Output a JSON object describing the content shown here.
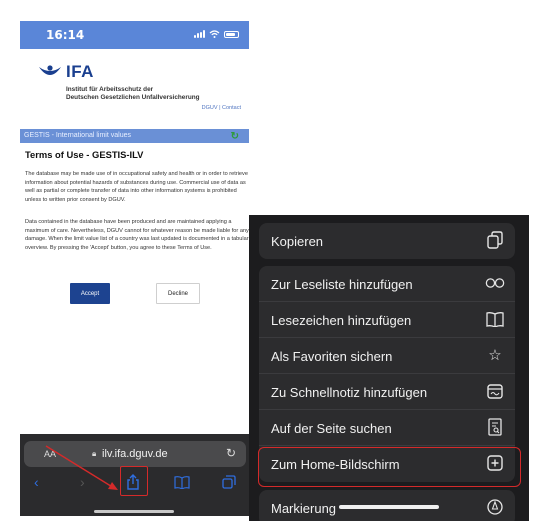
{
  "left_screen": {
    "status": {
      "time": "16:14"
    },
    "header": {
      "brand": "IFA",
      "institute_line1": "Institut für Arbeitsschutz der",
      "institute_line2": "Deutschen Gesetzlichen Unfallversicherung",
      "links": "DGUV | Contact"
    },
    "gestis_bar": "GESTIS - International limit values",
    "terms": {
      "title": "Terms of Use - GESTIS-ILV",
      "paragraph1": "The database may be made use of in occupational safety and health or in order to retrieve information about potential hazards of substances during use. Commercial use of data as well as partial or complete transfer of data into other information systems is prohibited unless to written prior consent by DGUV.",
      "paragraph2": "Data contained in the database have been produced and are maintained applying a maximum of care. Nevertheless, DGUV cannot for whatever reason be made liable for any damage. When the limit value list of a country was last updated is documented in a tabular overview. By pressing the 'Accept' button, you agree to these Terms of Use.",
      "accept_label": "Accept",
      "decline_label": "Decline"
    },
    "safari": {
      "aa": "AA",
      "url": "ilv.ifa.dguv.de"
    }
  },
  "share_menu": {
    "group1": [
      {
        "label": "Kopieren",
        "icon": "copy-icon"
      }
    ],
    "group2": [
      {
        "label": "Zur Leseliste hinzufügen",
        "icon": "glasses-icon"
      },
      {
        "label": "Lesezeichen hinzufügen",
        "icon": "book-icon"
      },
      {
        "label": "Als Favoriten sichern",
        "icon": "star-icon"
      },
      {
        "label": "Zu Schnellnotiz hinzufügen",
        "icon": "quick-note-icon"
      },
      {
        "label": "Auf der Seite suchen",
        "icon": "find-on-page-icon"
      },
      {
        "label": "Zum Home-Bildschirm",
        "icon": "add-square-icon"
      }
    ],
    "group3": [
      {
        "label": "Markierung",
        "icon": "markup-icon"
      }
    ]
  },
  "colors": {
    "annotation_red": "#d42a2a",
    "ios_blue": "#2f6ee0",
    "ifa_blue": "#1a3f8f"
  }
}
